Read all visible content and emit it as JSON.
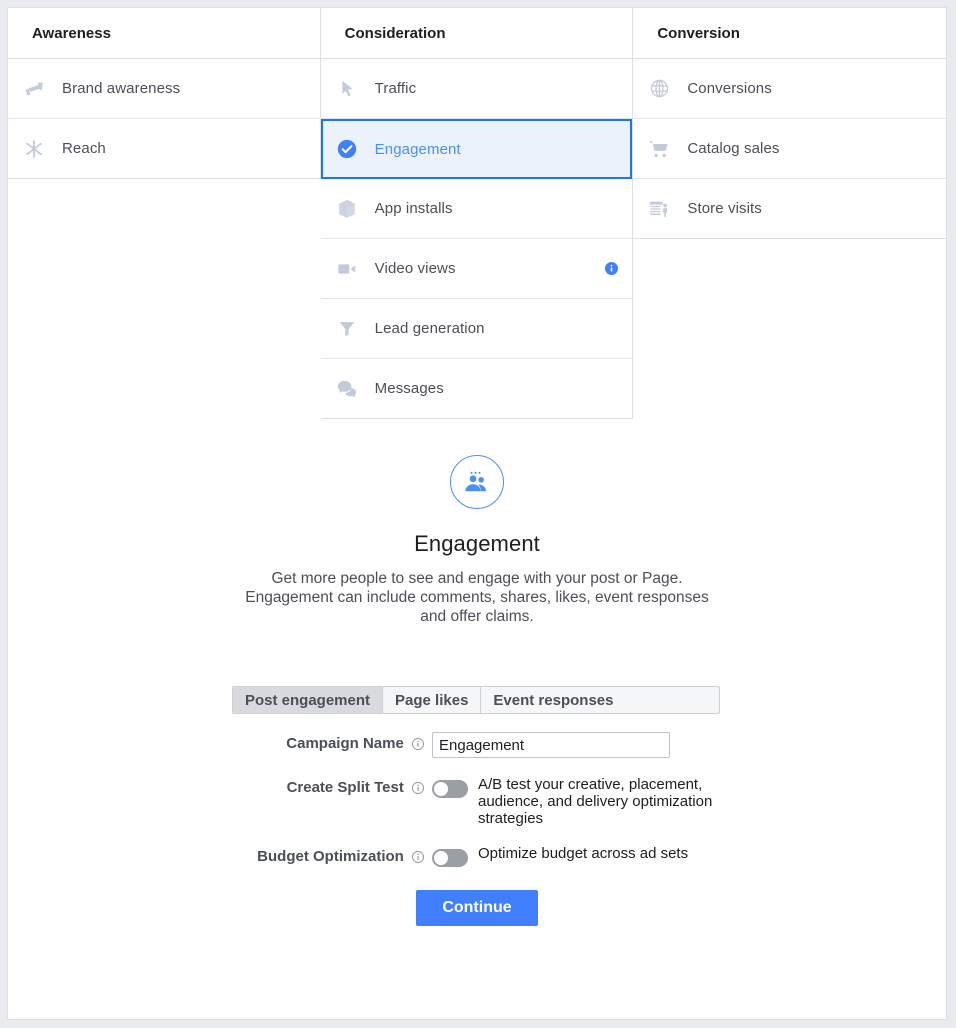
{
  "colors": {
    "accent_blue": "#1877f2",
    "button_blue": "#4080ff",
    "selected_row_bg": "#ebf2fb",
    "selected_text": "#4a90f5",
    "icon_gray": "#c3cbdb",
    "page_bg": "#e9ebee",
    "border": "#dddfe2",
    "tab_active_bg": "#d8dade"
  },
  "columns": [
    {
      "header": "Awareness",
      "items": [
        {
          "label": "Brand awareness",
          "icon": "megaphone-icon",
          "selected": false,
          "info": false
        },
        {
          "label": "Reach",
          "icon": "reach-burst-icon",
          "selected": false,
          "info": false
        }
      ]
    },
    {
      "header": "Consideration",
      "items": [
        {
          "label": "Traffic",
          "icon": "cursor-arrow-icon",
          "selected": false,
          "info": false
        },
        {
          "label": "Engagement",
          "icon": "check-circle-icon",
          "selected": true,
          "info": false
        },
        {
          "label": "App installs",
          "icon": "cube-box-icon",
          "selected": false,
          "info": false
        },
        {
          "label": "Video views",
          "icon": "video-camera-icon",
          "selected": false,
          "info": true
        },
        {
          "label": "Lead generation",
          "icon": "funnel-icon",
          "selected": false,
          "info": false
        },
        {
          "label": "Messages",
          "icon": "speech-bubbles-icon",
          "selected": false,
          "info": false
        }
      ]
    },
    {
      "header": "Conversion",
      "items": [
        {
          "label": "Conversions",
          "icon": "globe-icon",
          "selected": false,
          "info": false
        },
        {
          "label": "Catalog sales",
          "icon": "shopping-cart-icon",
          "selected": false,
          "info": false
        },
        {
          "label": "Store visits",
          "icon": "storefront-icon",
          "selected": false,
          "info": false
        }
      ]
    }
  ],
  "detail": {
    "icon": "people-group-icon",
    "title": "Engagement",
    "description": "Get more people to see and engage with your post or Page. Engagement can include comments, shares, likes, event responses and offer claims."
  },
  "form": {
    "tabs": [
      {
        "label": "Post engagement",
        "active": true
      },
      {
        "label": "Page likes",
        "active": false
      },
      {
        "label": "Event responses",
        "active": false
      }
    ],
    "campaign_name": {
      "label": "Campaign Name",
      "value": "Engagement",
      "placeholder": "Campaign Name",
      "info_icon": "info-icon"
    },
    "split_test": {
      "label": "Create Split Test",
      "description": "A/B test your creative, placement, audience, and delivery optimization strategies",
      "enabled": false,
      "info_icon": "info-icon"
    },
    "budget_optimization": {
      "label": "Budget Optimization",
      "description": "Optimize budget across ad sets",
      "enabled": false,
      "info_icon": "info-icon"
    },
    "continue_label": "Continue"
  }
}
